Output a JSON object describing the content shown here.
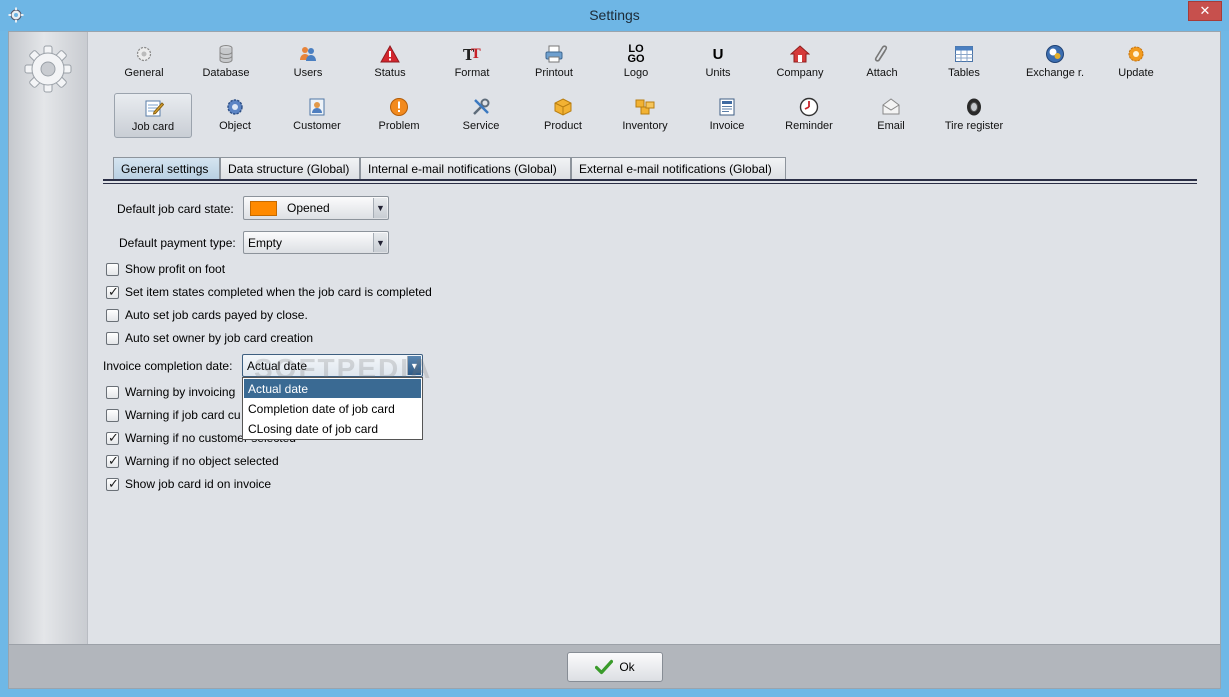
{
  "window": {
    "title": "Settings",
    "close_glyph": "✕"
  },
  "toolbar": {
    "row1": [
      {
        "label": "General",
        "icon": "gear-icon"
      },
      {
        "label": "Database",
        "icon": "database-icon"
      },
      {
        "label": "Users",
        "icon": "users-icon"
      },
      {
        "label": "Status",
        "icon": "warning-icon"
      },
      {
        "label": "Format",
        "icon": "format-icon"
      },
      {
        "label": "Printout",
        "icon": "printer-icon"
      },
      {
        "label": "Logo",
        "icon": "logo-icon"
      },
      {
        "label": "Units",
        "icon": "units-icon"
      },
      {
        "label": "Company",
        "icon": "house-icon"
      },
      {
        "label": "Attach",
        "icon": "paperclip-icon"
      },
      {
        "label": "Tables",
        "icon": "table-icon"
      },
      {
        "label": "Exchange r.",
        "icon": "currency-icon"
      },
      {
        "label": "Update",
        "icon": "update-icon"
      }
    ],
    "row2": [
      {
        "label": "Job card",
        "icon": "job-card-icon"
      },
      {
        "label": "Object",
        "icon": "object-gear-icon"
      },
      {
        "label": "Customer",
        "icon": "customer-icon"
      },
      {
        "label": "Problem",
        "icon": "problem-icon"
      },
      {
        "label": "Service",
        "icon": "tools-icon"
      },
      {
        "label": "Product",
        "icon": "box-icon"
      },
      {
        "label": "Inventory",
        "icon": "boxes-icon"
      },
      {
        "label": "Invoice",
        "icon": "invoice-icon"
      },
      {
        "label": "Reminder",
        "icon": "clock-icon"
      },
      {
        "label": "Email",
        "icon": "envelope-icon"
      },
      {
        "label": "Tire register",
        "icon": "tire-icon"
      }
    ],
    "logo_text_top": "LO",
    "logo_text_bottom": "GO",
    "units_glyph": "U"
  },
  "tabs": [
    {
      "label": "General settings"
    },
    {
      "label": "Data structure (Global)"
    },
    {
      "label": "Internal e-mail notifications (Global)"
    },
    {
      "label": "External e-mail notifications (Global)"
    }
  ],
  "form": {
    "job_card_state_label": "Default job card state:",
    "job_card_state_value": "Opened",
    "job_card_state_color": "#ff8a00",
    "payment_type_label": "Default payment type:",
    "payment_type_value": "Empty",
    "invoice_date_label": "Invoice completion date:",
    "invoice_date_value": "Actual date"
  },
  "checkboxes": [
    {
      "label": "Show profit on foot",
      "checked": false
    },
    {
      "label": "Set item states completed when the job card is completed",
      "checked": true
    },
    {
      "label": "Auto set job cards payed by close.",
      "checked": false
    },
    {
      "label": "Auto set owner by job card creation",
      "checked": false
    },
    {
      "label": "Warning by invoicing",
      "checked": false
    },
    {
      "label": "Warning if job card cu",
      "checked": false
    },
    {
      "label": "Warning if no customer selected",
      "checked": true
    },
    {
      "label": "Warning if no object selected",
      "checked": true
    },
    {
      "label": "Show job card id on invoice",
      "checked": true
    }
  ],
  "dropdown_options": [
    {
      "label": "Actual date",
      "selected": true
    },
    {
      "label": "Completion date of job card",
      "selected": false
    },
    {
      "label": "CLosing date of job card",
      "selected": false
    }
  ],
  "watermark": "SOFTPEDIA",
  "buttons": {
    "ok": "Ok"
  },
  "colors": {
    "title_bar": "#6eb6e5",
    "selection": "#3a6a93",
    "close": "#c7504d"
  }
}
